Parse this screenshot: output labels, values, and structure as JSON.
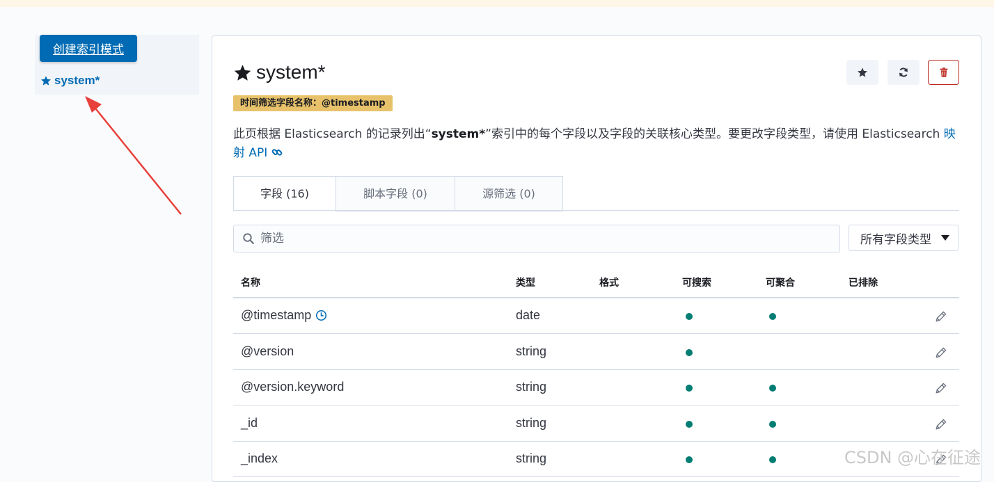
{
  "sidebar": {
    "create_button": "创建索引模式",
    "items": [
      {
        "label": "system*",
        "icon": "star-icon"
      }
    ]
  },
  "header": {
    "title": "system*",
    "badge": "时间筛选字段名称：@timestamp",
    "actions": [
      "star-icon",
      "refresh-icon",
      "trash-icon"
    ]
  },
  "description": {
    "prefix": "此页根据 Elasticsearch 的记录列出“",
    "index": "system*",
    "middle": "”索引中的每个字段以及字段的关联核心类型。要更改字段类型，请使用 Elasticsearch ",
    "link": "映射 API"
  },
  "tabs": [
    {
      "label": "字段 (16)",
      "active": true
    },
    {
      "label": "脚本字段 (0)",
      "active": false
    },
    {
      "label": "源筛选 (0)",
      "active": false
    }
  ],
  "filter": {
    "placeholder": "筛选",
    "type_select": "所有字段类型"
  },
  "table": {
    "columns": [
      "名称",
      "类型",
      "格式",
      "可搜索",
      "可聚合",
      "已排除"
    ],
    "rows": [
      {
        "name": "@timestamp",
        "type": "date",
        "searchable": true,
        "aggregatable": true,
        "time_field": true
      },
      {
        "name": "@version",
        "type": "string",
        "searchable": true,
        "aggregatable": false
      },
      {
        "name": "@version.keyword",
        "type": "string",
        "searchable": true,
        "aggregatable": true
      },
      {
        "name": "_id",
        "type": "string",
        "searchable": true,
        "aggregatable": true
      },
      {
        "name": "_index",
        "type": "string",
        "searchable": true,
        "aggregatable": true
      }
    ]
  },
  "watermark": "CSDN @心在征途",
  "colors": {
    "primary": "#006bb4",
    "badge": "#e8c26a",
    "danger": "#bd271e",
    "dot": "#017d73",
    "arrow": "#e8403a"
  }
}
